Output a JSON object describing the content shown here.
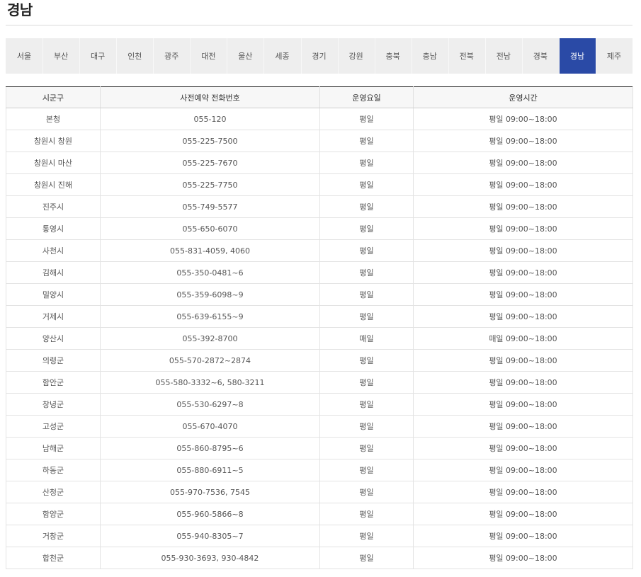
{
  "page": {
    "title": "경남"
  },
  "tabs": [
    {
      "label": "서울"
    },
    {
      "label": "부산"
    },
    {
      "label": "대구"
    },
    {
      "label": "인천"
    },
    {
      "label": "광주"
    },
    {
      "label": "대전"
    },
    {
      "label": "울산"
    },
    {
      "label": "세종"
    },
    {
      "label": "경기"
    },
    {
      "label": "강원"
    },
    {
      "label": "충북"
    },
    {
      "label": "충남"
    },
    {
      "label": "전북"
    },
    {
      "label": "전남"
    },
    {
      "label": "경북"
    },
    {
      "label": "경남"
    },
    {
      "label": "제주"
    }
  ],
  "active_tab": "경남",
  "colors": {
    "active_tab_bg": "#2a4aa6",
    "tab_bg": "#eeeeee"
  },
  "table": {
    "headers": [
      "시군구",
      "사전예약 전화번호",
      "운영요일",
      "운영시간"
    ],
    "rows": [
      [
        "본청",
        "055-120",
        "평일",
        "평일 09:00~18:00"
      ],
      [
        "창원시 창원",
        "055-225-7500",
        "평일",
        "평일 09:00~18:00"
      ],
      [
        "창원시 마산",
        "055-225-7670",
        "평일",
        "평일 09:00~18:00"
      ],
      [
        "창원시 진해",
        "055-225-7750",
        "평일",
        "평일 09:00~18:00"
      ],
      [
        "진주시",
        "055-749-5577",
        "평일",
        "평일 09:00~18:00"
      ],
      [
        "통영시",
        "055-650-6070",
        "평일",
        "평일 09:00~18:00"
      ],
      [
        "사천시",
        "055-831-4059, 4060",
        "평일",
        "평일 09:00~18:00"
      ],
      [
        "김해시",
        "055-350-0481~6",
        "평일",
        "평일 09:00~18:00"
      ],
      [
        "밀양시",
        "055-359-6098~9",
        "평일",
        "평일 09:00~18:00"
      ],
      [
        "거제시",
        "055-639-6155~9",
        "평일",
        "평일 09:00~18:00"
      ],
      [
        "양산시",
        "055-392-8700",
        "매일",
        "매일 09:00~18:00"
      ],
      [
        "의령군",
        "055-570-2872~2874",
        "평일",
        "평일 09:00~18:00"
      ],
      [
        "함안군",
        "055-580-3332~6, 580-3211",
        "평일",
        "평일 09:00~18:00"
      ],
      [
        "창녕군",
        "055-530-6297~8",
        "평일",
        "평일 09:00~18:00"
      ],
      [
        "고성군",
        "055-670-4070",
        "평일",
        "평일 09:00~18:00"
      ],
      [
        "남해군",
        "055-860-8795~6",
        "평일",
        "평일 09:00~18:00"
      ],
      [
        "하동군",
        "055-880-6911~5",
        "평일",
        "평일 09:00~18:00"
      ],
      [
        "산청군",
        "055-970-7536, 7545",
        "평일",
        "평일 09:00~18:00"
      ],
      [
        "함양군",
        "055-960-5866~8",
        "평일",
        "평일 09:00~18:00"
      ],
      [
        "거창군",
        "055-940-8305~7",
        "평일",
        "평일 09:00~18:00"
      ],
      [
        "합천군",
        "055-930-3693, 930-4842",
        "평일",
        "평일 09:00~18:00"
      ]
    ]
  }
}
